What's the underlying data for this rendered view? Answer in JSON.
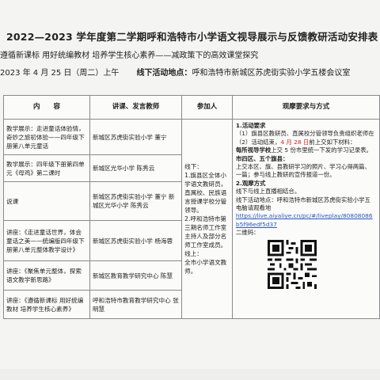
{
  "doc": {
    "title": "2022—2023 学年度第二学期呼和浩特市小学语文视导展示与反馈教研活动安排表",
    "theme": "遵循新课标  用好统编教材  培养学生核心素养——减政策下的高效课堂探究",
    "date": "2023 年 4 月 25 日（周二）上午",
    "location_label": "线下活动地点：",
    "location": "呼和浩特市新城区苏虎街实验小学五楼会议室"
  },
  "table": {
    "headers": [
      "内　　容",
      "讲课、发言教师",
      "参加人",
      "观摩要求与方式"
    ],
    "rows": [
      {
        "content": "教学展示：走进童话体验情，奇妙之旅初体验——四年级下册第八单元童话",
        "teacher": "新城区苏虎街实验小学 董宁"
      },
      {
        "content": "教学展示：四年级下册第四单元《母鸡》第二课时",
        "teacher": "新城区光华小学 陈秀云"
      },
      {
        "content": "说课",
        "teacher": "新城区苏虎街实验小学 董宁 新城区光华小学 陈秀云"
      },
      {
        "content": "讲座：《走进童话世界，体会童话之美——统编版四年级下册第八单元整体教学设计》",
        "teacher": "新城区苏虎街实验小学 杨海蓉"
      },
      {
        "content": "讲座：《聚焦单元整体，探索语文教学新思路》",
        "teacher": "新城区教育教学研究中心 陈慧"
      },
      {
        "content": "讲座：《遵循新课标 用好统编教材 培养学生核心素养》",
        "teacher": "呼和浩特市教育教学研究中心 张明慧"
      }
    ],
    "participants": {
      "offline_label": "线下：",
      "offline_1": "1.旗县区全体小学语文教研员，直属校、民族语言授课学校分管领导。",
      "offline_2": "2.呼和浩特市第三期名师工作室主持人及部分名师工作室成员。",
      "online_label": "线上：",
      "online": "全市小学语文教师。"
    },
    "requirements": {
      "s1_title": "1.活动要求",
      "s1_item1": "（1）旗县区教研员、直属校分管领导负责组织老师在",
      "s1_item2_pre": "（2）活动结束，",
      "s1_item2_red": "4 月 28 日",
      "s1_item2_post": "前上交如下材料：",
      "s2_title": "每所视导学校",
      "s2_text": "上交 5 份市里统一下发的学习记录表。",
      "s3_title": "市四区、五个旗县：",
      "s3_text": "上交本区、旗、县教研学习的照片、学习心得两篇、一篇；参与线上教研的宣传报道一份。",
      "s4_title": "2.观摩方式",
      "s4_text": "线下与线上直播相结合。",
      "s5_text": "线下活动地点：呼和浩特市新城区苏虎街实验小学五",
      "s5_label": "电脑请观看地",
      "s5_link": "https://live.aiyaliye.cn/pc/#/liveplay/80808086b5f96edf5d37",
      "s6": "二维码："
    }
  }
}
